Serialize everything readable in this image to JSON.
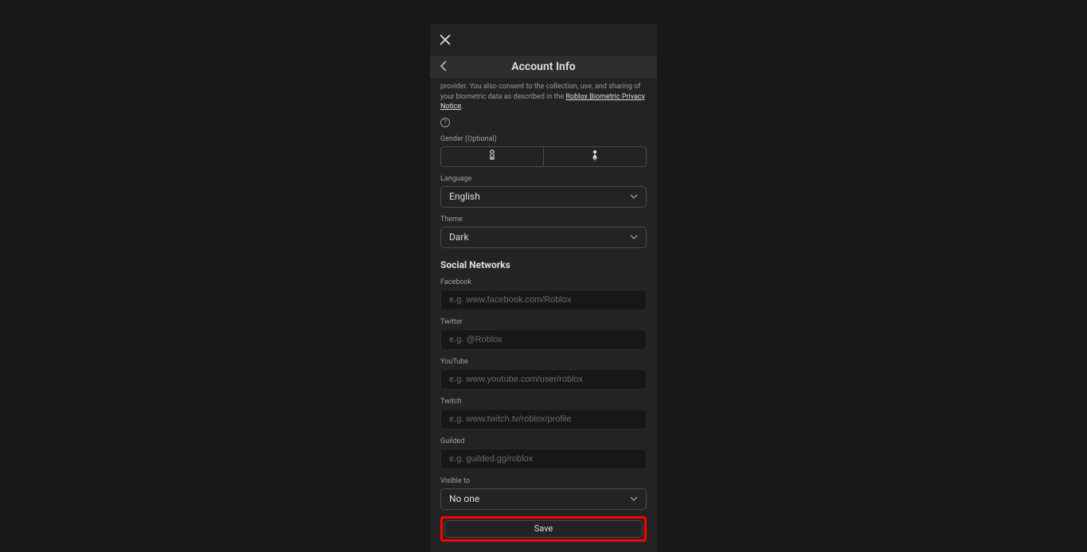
{
  "header": {
    "title": "Account Info"
  },
  "consent": {
    "text_fragment": "provider. You also consent to the collection, use, and sharing of your biometric data as described in the ",
    "link_text": "Roblox Biometric Privacy Notice",
    "period": "."
  },
  "gender": {
    "label": "Gender (Optional)"
  },
  "language": {
    "label": "Language",
    "value": "English"
  },
  "theme": {
    "label": "Theme",
    "value": "Dark"
  },
  "social": {
    "title": "Social Networks",
    "facebook": {
      "label": "Facebook",
      "placeholder": "e.g. www.facebook.com/Roblox"
    },
    "twitter": {
      "label": "Twitter",
      "placeholder": "e.g. @Roblox"
    },
    "youtube": {
      "label": "YouTube",
      "placeholder": "e.g. www.youtube.com/user/roblox"
    },
    "twitch": {
      "label": "Twitch",
      "placeholder": "e.g. www.twitch.tv/roblox/profile"
    },
    "guilded": {
      "label": "Guilded",
      "placeholder": "e.g. guilded.gg/roblox"
    },
    "visible": {
      "label": "Visible to",
      "value": "No one"
    }
  },
  "save": {
    "label": "Save"
  }
}
